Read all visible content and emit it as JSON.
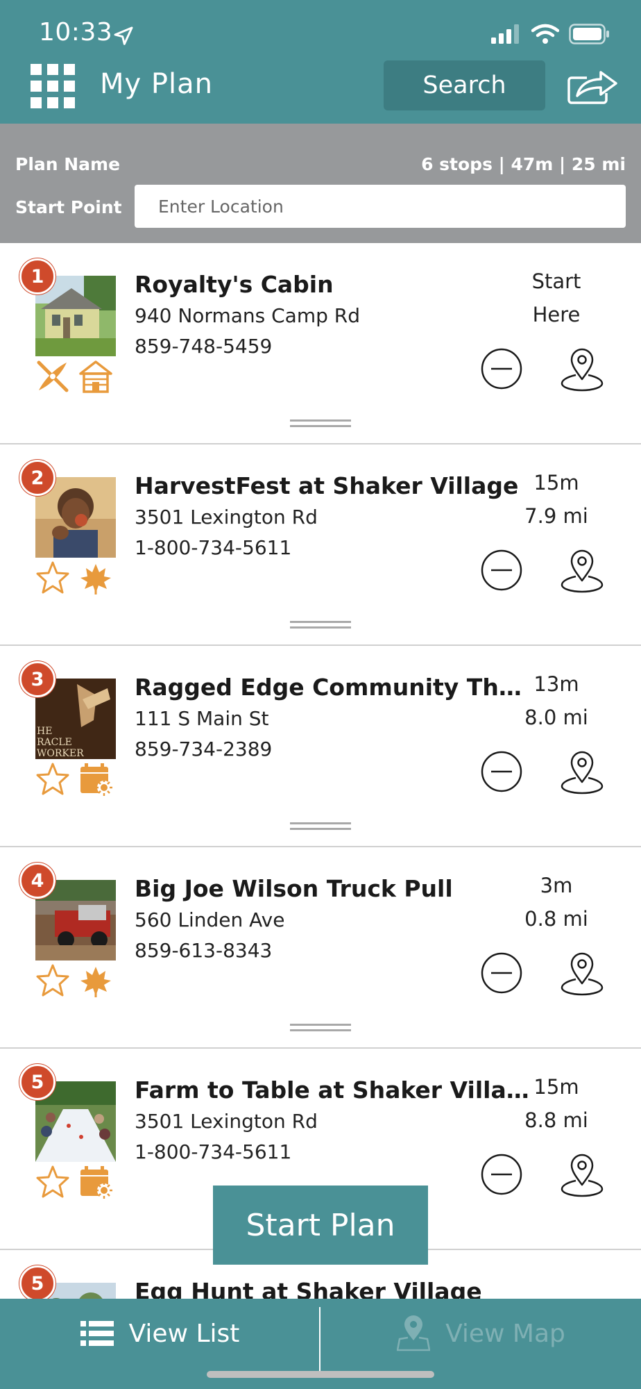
{
  "status": {
    "time": "10:33"
  },
  "header": {
    "title": "My Plan",
    "search_label": "Search"
  },
  "plan": {
    "name_label": "Plan Name",
    "summary": "6 stops | 47m | 25 mi",
    "start_label": "Start Point",
    "start_placeholder": "Enter Location"
  },
  "stops": [
    {
      "number": "1",
      "name": "Royalty's Cabin",
      "address": "940 Normans Camp Rd",
      "phone": "859-748-5459",
      "time": "Start",
      "distance": "Here",
      "icons": [
        "kayak-icon",
        "cabin-icon"
      ]
    },
    {
      "number": "2",
      "name": "HarvestFest at Shaker Village",
      "address": "3501 Lexington Rd",
      "phone": "1-800-734-5611",
      "time": "15m",
      "distance": "7.9 mi",
      "icons": [
        "star-icon",
        "leaves-icon"
      ]
    },
    {
      "number": "3",
      "name": "Ragged Edge Community Thea…",
      "address": "111 S Main St",
      "phone": "859-734-2389",
      "time": "13m",
      "distance": "8.0 mi",
      "icons": [
        "star-icon",
        "event-calendar-icon"
      ]
    },
    {
      "number": "4",
      "name": "Big Joe Wilson Truck Pull",
      "address": "560 Linden Ave",
      "phone": "859-613-8343",
      "time": "3m",
      "distance": "0.8 mi",
      "icons": [
        "star-icon",
        "leaves-icon"
      ]
    },
    {
      "number": "5",
      "name": "Farm to Table at Shaker Village",
      "address": "3501 Lexington Rd",
      "phone": "1-800-734-5611",
      "time": "15m",
      "distance": "8.8 mi",
      "icons": [
        "star-icon",
        "event-calendar-icon"
      ]
    },
    {
      "number": "5",
      "name": "Egg Hunt at Shaker Village",
      "address": "",
      "phone": "",
      "time": "",
      "distance": "",
      "icons": []
    }
  ],
  "start_plan_label": "Start Plan",
  "tabs": {
    "list_label": "View List",
    "map_label": "View Map"
  },
  "colors": {
    "teal": "#4a9196",
    "dark_teal": "#3d7d82",
    "badge_red": "#cf4a2b",
    "icon_orange": "#e89a3c",
    "plan_bar_gray": "#97999b"
  }
}
